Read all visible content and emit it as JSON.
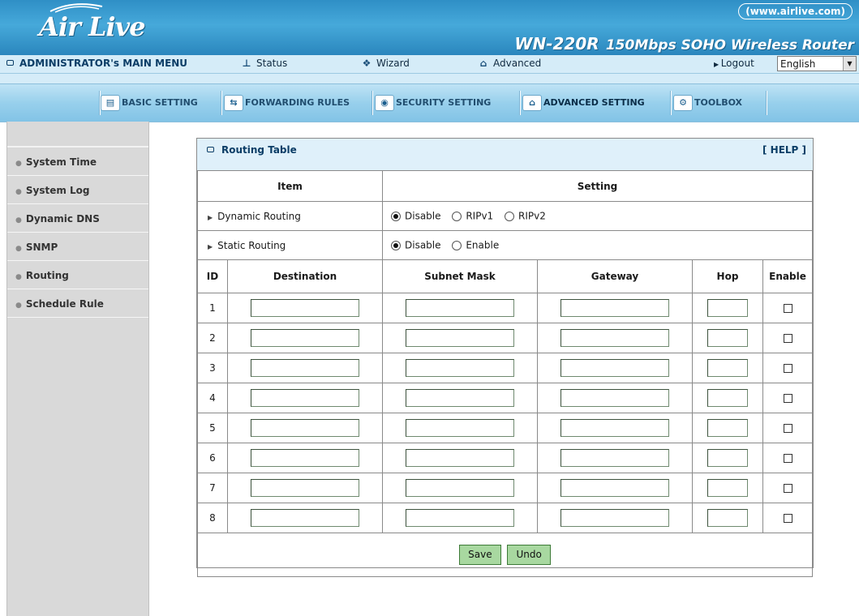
{
  "header": {
    "logo": "Air Live",
    "url": "(www.airlive.com)",
    "model": "WN-220R",
    "model_desc": "150Mbps SOHO Wireless Router"
  },
  "main_menu": {
    "admin": "ADMINISTRATOR's MAIN MENU",
    "status": "Status",
    "wizard": "Wizard",
    "advanced": "Advanced",
    "logout": "Logout",
    "language": "English"
  },
  "tabs": [
    {
      "label": "BASIC SETTING",
      "icon": "folder-icon"
    },
    {
      "label": "FORWARDING RULES",
      "icon": "arrows-icon"
    },
    {
      "label": "SECURITY SETTING",
      "icon": "lock-icon"
    },
    {
      "label": "ADVANCED SETTING",
      "icon": "advanced-icon"
    },
    {
      "label": "TOOLBOX",
      "icon": "toolbox-icon"
    }
  ],
  "sidebar": {
    "items": [
      {
        "label": "System Time"
      },
      {
        "label": "System Log"
      },
      {
        "label": "Dynamic DNS"
      },
      {
        "label": "SNMP"
      },
      {
        "label": "Routing"
      },
      {
        "label": "Schedule Rule"
      }
    ]
  },
  "panel": {
    "title": "Routing Table",
    "help": "[ HELP ]",
    "col_item": "Item",
    "col_setting": "Setting",
    "dynamic_routing": {
      "label": "Dynamic Routing",
      "options": [
        "Disable",
        "RIPv1",
        "RIPv2"
      ],
      "selected": "Disable"
    },
    "static_routing": {
      "label": "Static Routing",
      "options": [
        "Disable",
        "Enable"
      ],
      "selected": "Disable"
    },
    "grid_headers": [
      "ID",
      "Destination",
      "Subnet Mask",
      "Gateway",
      "Hop",
      "Enable"
    ],
    "rows": [
      {
        "id": "1",
        "destination": "",
        "subnet_mask": "",
        "gateway": "",
        "hop": "",
        "enable": false
      },
      {
        "id": "2",
        "destination": "",
        "subnet_mask": "",
        "gateway": "",
        "hop": "",
        "enable": false
      },
      {
        "id": "3",
        "destination": "",
        "subnet_mask": "",
        "gateway": "",
        "hop": "",
        "enable": false
      },
      {
        "id": "4",
        "destination": "",
        "subnet_mask": "",
        "gateway": "",
        "hop": "",
        "enable": false
      },
      {
        "id": "5",
        "destination": "",
        "subnet_mask": "",
        "gateway": "",
        "hop": "",
        "enable": false
      },
      {
        "id": "6",
        "destination": "",
        "subnet_mask": "",
        "gateway": "",
        "hop": "",
        "enable": false
      },
      {
        "id": "7",
        "destination": "",
        "subnet_mask": "",
        "gateway": "",
        "hop": "",
        "enable": false
      },
      {
        "id": "8",
        "destination": "",
        "subnet_mask": "",
        "gateway": "",
        "hop": "",
        "enable": false
      }
    ],
    "save_label": "Save",
    "undo_label": "Undo"
  }
}
